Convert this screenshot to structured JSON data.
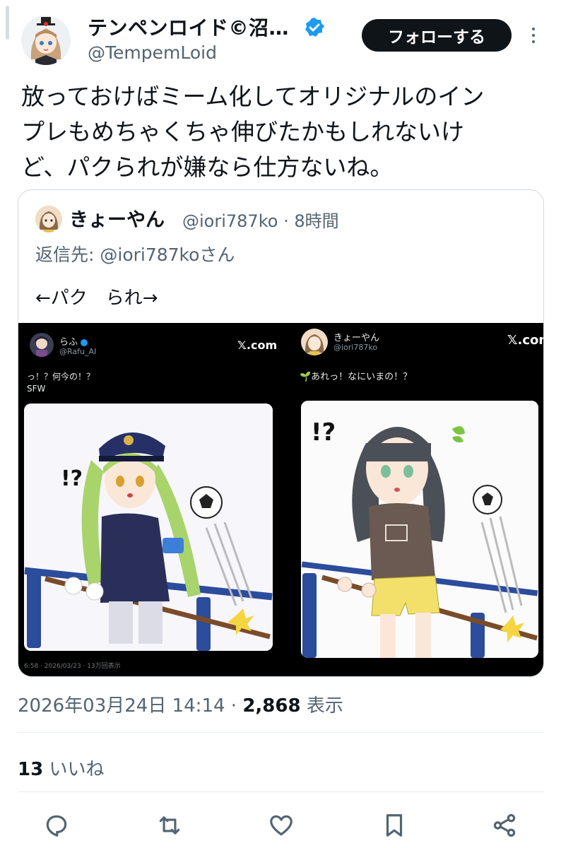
{
  "author": {
    "display_name": "テンペンロイド©沼…",
    "handle": "@TempemLoid",
    "avatar_icon": "anime-girl-avatar",
    "verified_icon": "verified-badge-icon"
  },
  "follow_button": {
    "label": "フォローする"
  },
  "more_icon": "more-options-icon",
  "tweet": {
    "text": "放っておけばミーム化してオリジナルのイン\nプレもめちゃくちゃ伸びたかもしれないけ\nど、パクられが嫌なら仕方ないね。"
  },
  "quote": {
    "name": "きょーやん",
    "handle": "@iori787ko",
    "separator": "·",
    "time": "8時間",
    "reply_to": "返信先: @iori787koさん",
    "body": "←パク　られ→",
    "left_panel": {
      "name": "らふ",
      "handle": "@Rafu_AI",
      "xcom": "𝕏.com",
      "text": "っ！？何今の！？\nSFW",
      "exclaim": "!?",
      "footer": "6:58 · 2026/03/23 · 13万回表示"
    },
    "right_panel": {
      "name": "きょーやん",
      "handle": "@iori787ko",
      "xcom": "𝕏.com",
      "text": "🌱あれっ！なにいまの！？",
      "exclaim": "!?"
    }
  },
  "meta": {
    "timestamp": "2026年03月24日 14:14",
    "separator": "·",
    "views": "2,868",
    "views_label": "表示"
  },
  "likes": {
    "count": "13",
    "label": "いいね"
  },
  "actions": [
    {
      "icon": "reply-icon"
    },
    {
      "icon": "retweet-icon"
    },
    {
      "icon": "like-icon"
    },
    {
      "icon": "bookmark-icon"
    },
    {
      "icon": "share-icon"
    }
  ],
  "colors": {
    "text": "#0f1419",
    "secondary": "#536471",
    "verified": "#1d9bf0",
    "border": "#cfd9de"
  }
}
